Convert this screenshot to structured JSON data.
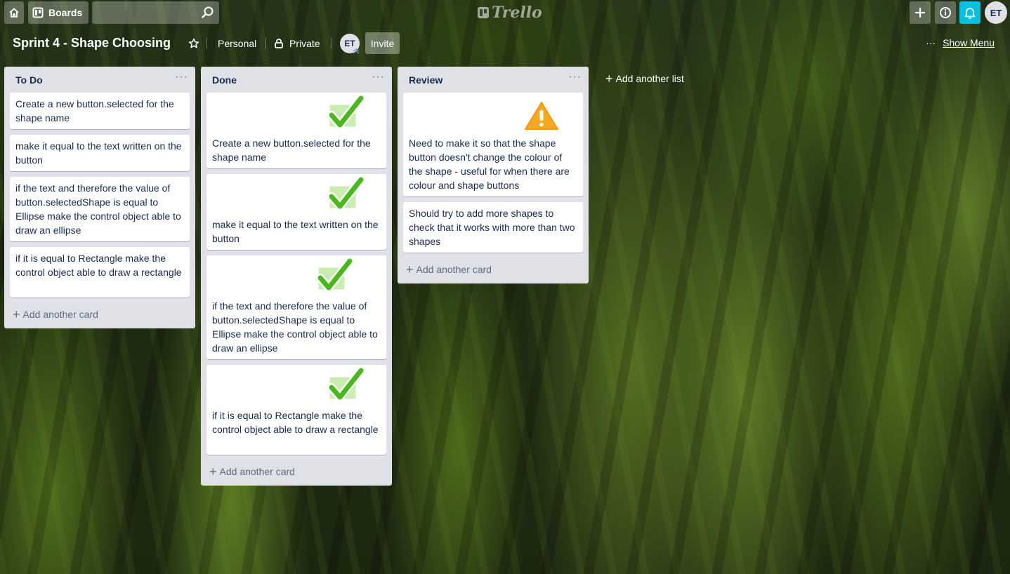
{
  "header": {
    "boards_label": "Boards",
    "search_value": "",
    "logo_text": "Trello",
    "user_initials": "ET",
    "notification_color": "#00c2e0"
  },
  "board": {
    "title": "Sprint 4 - Shape Choosing",
    "team": "Personal",
    "visibility": "Private",
    "member_initials": "ET",
    "invite_label": "Invite",
    "show_menu_label": "Show Menu"
  },
  "lists": [
    {
      "title": "To Do",
      "cards": [
        {
          "text": "Create a new button.selected for the shape name"
        },
        {
          "text": "make it equal to the text written on the button"
        },
        {
          "text": "if the text and therefore the value of button.selectedShape is equal to Ellipse make the control object able to draw an ellipse"
        },
        {
          "text": "if it is equal to Rectangle make the control object able to draw a rectangle"
        }
      ],
      "add_card_label": "Add another card"
    },
    {
      "title": "Done",
      "cards": [
        {
          "text": "Create a new button.selected for the shape name",
          "icon": "checkmark-sticker-icon"
        },
        {
          "text": "make it equal to the text written on the button",
          "icon": "checkmark-sticker-icon"
        },
        {
          "text": "if the text and therefore the value of button.selectedShape is equal to Ellipse make the control object able to draw an ellipse",
          "icon": "checkmark-sticker-icon"
        },
        {
          "text": "if it is equal to Rectangle make the control object able to draw a rectangle",
          "icon": "checkmark-sticker-icon"
        }
      ],
      "add_card_label": "Add another card"
    },
    {
      "title": "Review",
      "cards": [
        {
          "text": "Need to make it so that the shape button doesn't change the colour of the shape - useful for when there are colour and shape buttons",
          "icon": "warning-sticker-icon"
        },
        {
          "text": "Should try to add more shapes to check that it works with more than two shapes"
        }
      ],
      "add_card_label": "Add another card"
    }
  ],
  "add_list_label": "Add another list"
}
